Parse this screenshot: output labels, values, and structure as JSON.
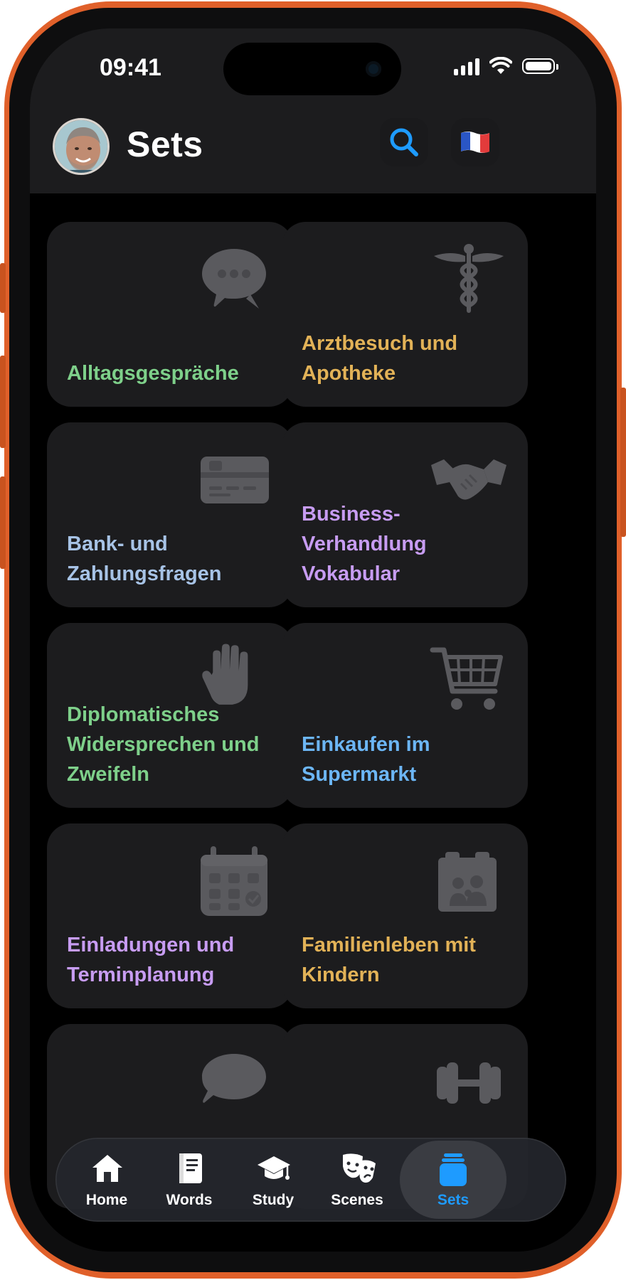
{
  "status": {
    "time": "09:41"
  },
  "header": {
    "title": "Sets"
  },
  "colors": {
    "green": "#7ed08a",
    "gold": "#e2b257",
    "blue_gray": "#a7c3e6",
    "purple": "#c79cf2",
    "sky": "#6cb6f5",
    "accent": "#1e9bff",
    "orange_frame": "#e0602a"
  },
  "sets": [
    {
      "label": "Alltagsgespräche",
      "icon": "speech-bubble-icon",
      "color": "#7ed08a"
    },
    {
      "label": "Arztbesuch und Apotheke",
      "icon": "caduceus-icon",
      "color": "#e2b257"
    },
    {
      "label": "Bank- und Zahlungsfragen",
      "icon": "credit-card-icon",
      "color": "#a7c3e6"
    },
    {
      "label": "Business-Verhandlung Vokabular",
      "icon": "handshake-icon",
      "color": "#c79cf2"
    },
    {
      "label": "Diplomatisches Widersprechen und Zweifeln",
      "icon": "raised-hand-icon",
      "color": "#7ed08a"
    },
    {
      "label": "Einkaufen im Supermarkt",
      "icon": "shopping-cart-icon",
      "color": "#6cb6f5"
    },
    {
      "label": "Einladungen und Terminplanung",
      "icon": "calendar-icon",
      "color": "#c79cf2"
    },
    {
      "label": "Familienleben mit Kindern",
      "icon": "family-photo-icon",
      "color": "#e2b257"
    },
    {
      "label": "",
      "icon": "chat-bubble-icon",
      "color": "#6cb6f5"
    },
    {
      "label": "",
      "icon": "dumbbell-icon",
      "color": "#e2624a"
    }
  ],
  "tabs": [
    {
      "label": "Home",
      "icon": "house-icon"
    },
    {
      "label": "Words",
      "icon": "book-icon"
    },
    {
      "label": "Study",
      "icon": "graduation-cap-icon"
    },
    {
      "label": "Scenes",
      "icon": "theater-masks-icon"
    },
    {
      "label": "Sets",
      "icon": "stack-icon",
      "active": true
    }
  ]
}
